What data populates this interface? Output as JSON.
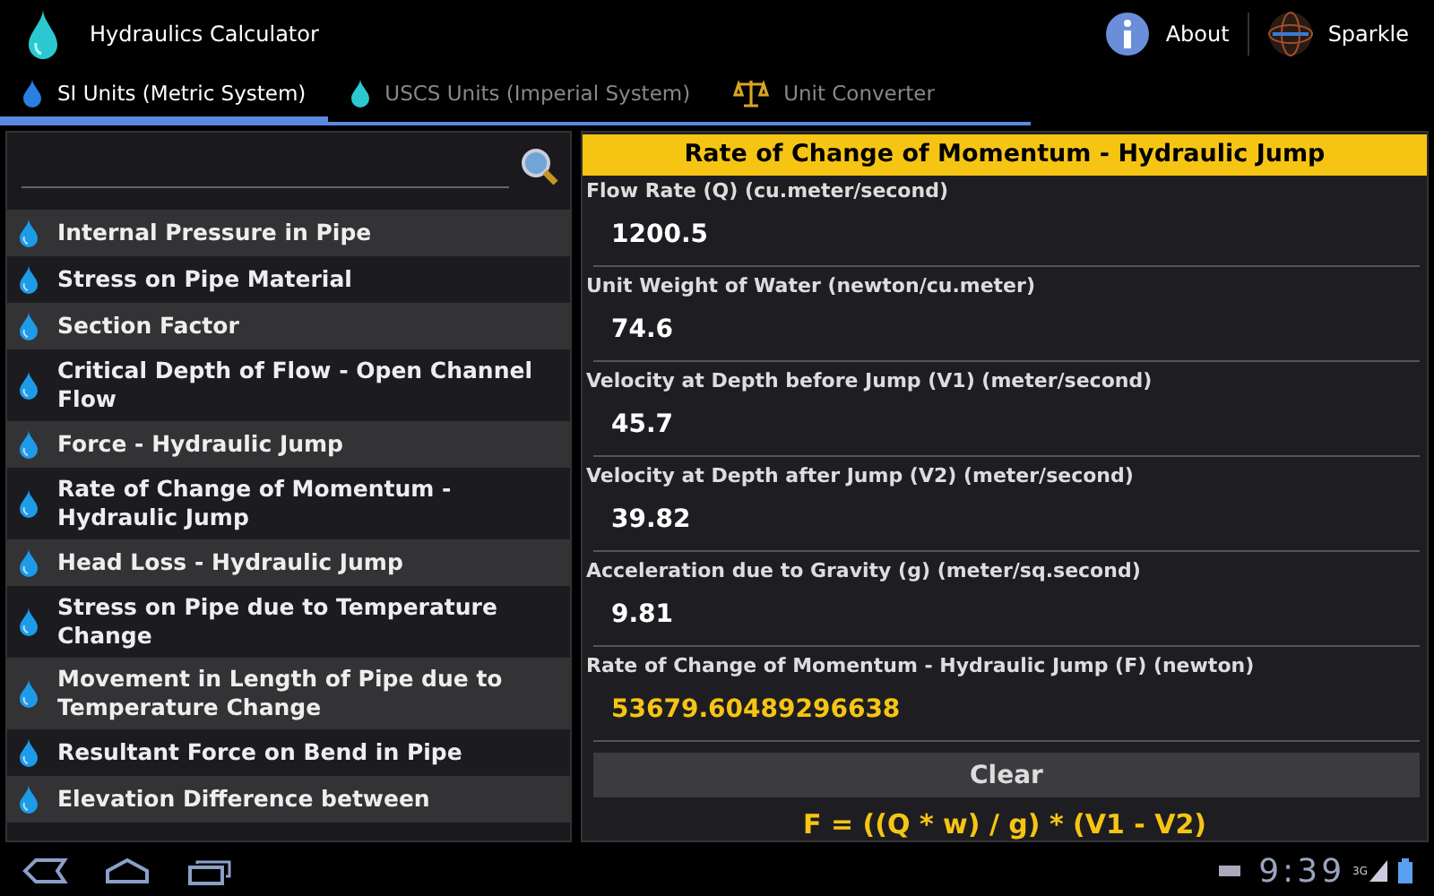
{
  "app": {
    "title": "Hydraulics Calculator",
    "actions": [
      {
        "label": "About",
        "kind": "info"
      },
      {
        "label": "Sparkle",
        "kind": "globe"
      }
    ]
  },
  "tabs": [
    {
      "label": "SI Units (Metric System)",
      "selected": true,
      "kind": "drop"
    },
    {
      "label": "USCS Units (Imperial System)",
      "selected": false,
      "kind": "drop"
    },
    {
      "label": "Unit Converter",
      "selected": false,
      "kind": "scale"
    }
  ],
  "topics": [
    {
      "label": "Internal Pressure in Pipe"
    },
    {
      "label": "Stress on Pipe Material"
    },
    {
      "label": "Section Factor"
    },
    {
      "label": "Critical Depth of Flow - Open Channel Flow"
    },
    {
      "label": "Force - Hydraulic Jump"
    },
    {
      "label": "Rate of Change of Momentum - Hydraulic Jump"
    },
    {
      "label": "Head Loss - Hydraulic Jump"
    },
    {
      "label": "Stress on Pipe due to Temperature Change"
    },
    {
      "label": "Movement in Length of Pipe due to Temperature Change"
    },
    {
      "label": "Resultant Force on Bend in Pipe"
    },
    {
      "label": "Elevation Difference between"
    }
  ],
  "calculator": {
    "title": "Rate of Change of Momentum - Hydraulic Jump",
    "fields": [
      {
        "label": "Flow Rate (Q) (cu.meter/second)",
        "value": "1200.5",
        "kind": "input"
      },
      {
        "label": "Unit Weight of Water (newton/cu.meter)",
        "value": "74.6",
        "kind": "input"
      },
      {
        "label": "Velocity at Depth before Jump (V1) (meter/second)",
        "value": "45.7",
        "kind": "input"
      },
      {
        "label": "Velocity at Depth after Jump (V2) (meter/second)",
        "value": "39.82",
        "kind": "input"
      },
      {
        "label": "Acceleration due to Gravity (g) (meter/sq.second)",
        "value": "9.81",
        "kind": "input"
      },
      {
        "label": "Rate of Change of Momentum - Hydraulic Jump (F) (newton)",
        "value": "53679.60489296638",
        "kind": "result"
      }
    ],
    "clear_button": "Clear",
    "formula": "F = ((Q * w) / g) * (V1 - V2)"
  },
  "status_bar": {
    "time": "9:39",
    "network": "3G"
  }
}
